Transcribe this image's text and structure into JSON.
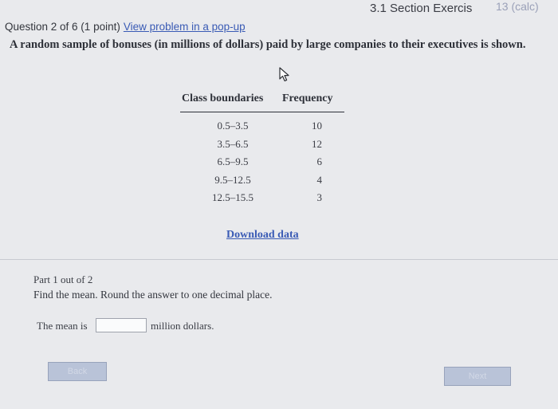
{
  "header": {
    "section_title": "3.1 Section Exercis",
    "section_suffix": "13 (calc)",
    "question": "Question 2 of 6 (1 point)",
    "popup_link": "View problem in a pop-up"
  },
  "problem": {
    "text": "A random sample of bonuses (in millions of dollars) paid by large companies to their executives is shown."
  },
  "table": {
    "headers": [
      "Class boundaries",
      "Frequency"
    ],
    "rows": [
      {
        "class": "0.5–3.5",
        "freq": "10"
      },
      {
        "class": "3.5–6.5",
        "freq": "12"
      },
      {
        "class": "6.5–9.5",
        "freq": "6"
      },
      {
        "class": "9.5–12.5",
        "freq": "4"
      },
      {
        "class": "12.5–15.5",
        "freq": "3"
      }
    ]
  },
  "download_link": "Download data",
  "part": {
    "label": "Part 1 out of 2",
    "instruction": "Find the mean. Round the answer to one decimal place.",
    "mean_prefix": "The mean is",
    "mean_value": "",
    "mean_suffix": "million dollars."
  },
  "buttons": {
    "back": "Back",
    "next": "Next"
  },
  "icons": {
    "cursor": "mouse-pointer-icon"
  }
}
